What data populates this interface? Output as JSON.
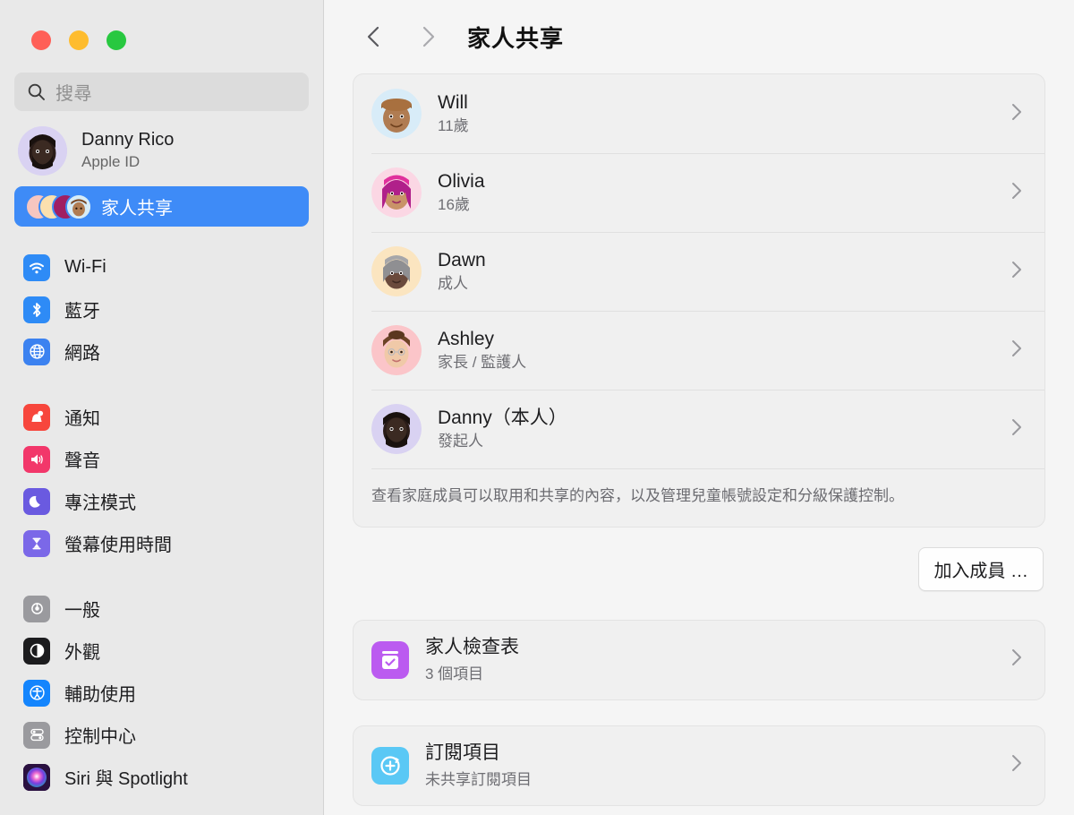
{
  "window": {
    "traffic_lights": [
      {
        "name": "close",
        "color": "#ff5f57"
      },
      {
        "name": "minimize",
        "color": "#febc2e"
      },
      {
        "name": "zoom",
        "color": "#28c840"
      }
    ]
  },
  "sidebar": {
    "search": {
      "placeholder": "搜尋",
      "value": ""
    },
    "account": {
      "name": "Danny Rico",
      "subtitle": "Apple ID"
    },
    "family_item": {
      "label": "家人共享",
      "selected": true,
      "accent": "#3e8bf7"
    },
    "groups": [
      {
        "items": [
          {
            "label": "Wi-Fi",
            "icon": "wifi-icon",
            "color": "#2e8bf6"
          },
          {
            "label": "藍牙",
            "icon": "bluetooth-icon",
            "color": "#2e8bf6"
          },
          {
            "label": "網路",
            "icon": "globe-icon",
            "color": "#3c82f0"
          }
        ]
      },
      {
        "items": [
          {
            "label": "通知",
            "icon": "bell-icon",
            "color": "#f7463c"
          },
          {
            "label": "聲音",
            "icon": "speaker-icon",
            "color": "#f2376a"
          },
          {
            "label": "專注模式",
            "icon": "moon-icon",
            "color": "#6a5ae0"
          },
          {
            "label": "螢幕使用時間",
            "icon": "hourglass-icon",
            "color": "#7b68e8"
          }
        ]
      },
      {
        "items": [
          {
            "label": "一般",
            "icon": "gear-icon",
            "color": "#9a9a9e"
          },
          {
            "label": "外觀",
            "icon": "appearance-icon",
            "color": "#1c1c1e"
          },
          {
            "label": "輔助使用",
            "icon": "accessibility-icon",
            "color": "#1485fd"
          },
          {
            "label": "控制中心",
            "icon": "control-center-icon",
            "color": "#9a9a9e"
          },
          {
            "label": "Siri 與 Spotlight",
            "icon": "siri-icon",
            "color": "#5c3a8e"
          }
        ]
      }
    ]
  },
  "toolbar": {
    "back_icon": "chevron-left-icon",
    "forward_icon": "chevron-right-icon",
    "title": "家人共享"
  },
  "members": {
    "rows": [
      {
        "name": "Will",
        "subtitle": "11歲",
        "avatar_bg": "#d8ecf8",
        "chevron": "chevron-right-icon"
      },
      {
        "name": "Olivia",
        "subtitle": "16歲",
        "avatar_bg": "#fbd7e4",
        "chevron": "chevron-right-icon"
      },
      {
        "name": "Dawn",
        "subtitle": "成人",
        "avatar_bg": "#fbe5c0",
        "chevron": "chevron-right-icon"
      },
      {
        "name": "Ashley",
        "subtitle": "家長 / 監護人",
        "avatar_bg": "#fbc5c9",
        "chevron": "chevron-right-icon"
      },
      {
        "name": "Danny（本人）",
        "subtitle": "發起人",
        "avatar_bg": "#d9d2f2",
        "chevron": "chevron-right-icon"
      }
    ],
    "description": "查看家庭成員可以取用和共享的內容，以及管理兒童帳號設定和分級保護控制。",
    "add_member_label": "加入成員 …"
  },
  "sections": {
    "rows": [
      {
        "title": "家人檢查表",
        "subtitle": "3 個項目",
        "icon": "checklist-icon",
        "color": "#bb5bf0",
        "chevron": "chevron-right-icon"
      },
      {
        "title": "訂閱項目",
        "subtitle": "未共享訂閱項目",
        "icon": "subscription-icon",
        "color": "#5ac8f5",
        "chevron": "chevron-right-icon"
      }
    ]
  }
}
